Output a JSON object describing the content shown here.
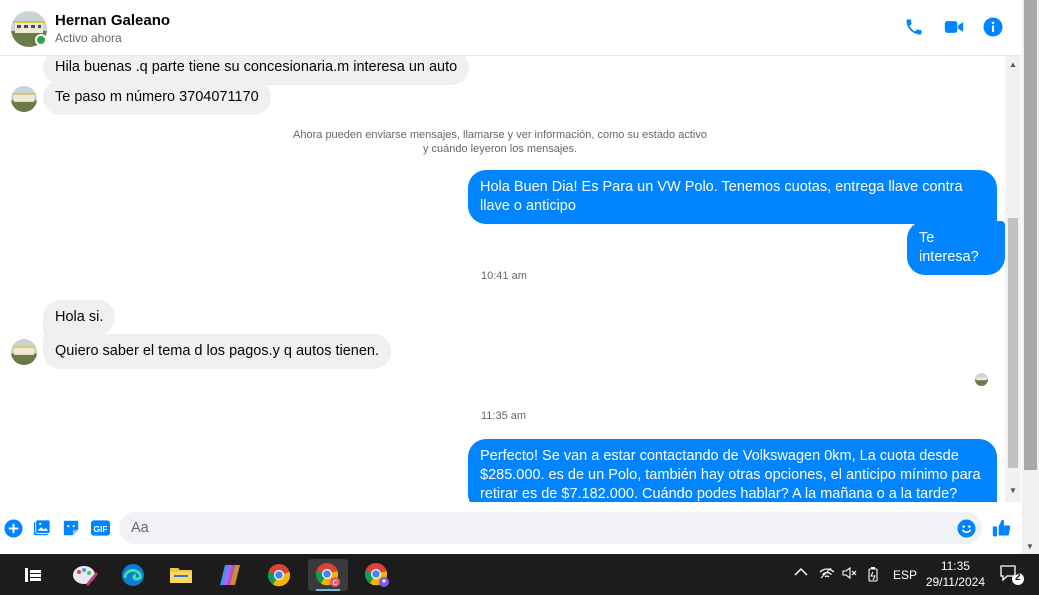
{
  "header": {
    "contact_name": "Hernan Galeano",
    "status": "Activo ahora",
    "icons": [
      "phone-icon",
      "video-icon",
      "info-icon"
    ],
    "accent": "#0084ff"
  },
  "messages": [
    {
      "dir": "in",
      "text": "Hila buenas .q parte tiene su concesionaria.m interesa un auto"
    },
    {
      "dir": "in",
      "text": "Te paso m número 3704071170"
    },
    {
      "dir": "out",
      "text": "Hola Buen Dia! Es Para un VW Polo. Tenemos cuotas, entrega llave contra llave o anticipo"
    },
    {
      "dir": "out",
      "text": "Te interesa?"
    },
    {
      "dir": "in",
      "text": "Hola si."
    },
    {
      "dir": "in",
      "text": "Quiero saber el tema d los pagos.y q autos tienen."
    },
    {
      "dir": "out",
      "text": "Perfecto!  Se van a estar contactando de Volkswagen 0km, La cuota desde $285.000. es de un Polo, también hay otras opciones, el anticipo mínimo para retirar es de $7.182.000. Cuándo podes hablar? A la mañana o a la tarde?"
    }
  ],
  "system_note": {
    "line1": "Ahora pueden enviarse mensajes, llamarse y ver información, como su estado activo",
    "line2": "y cuándo leyeron los mensajes."
  },
  "timestamps": [
    "10:41 am",
    "11:35 am"
  ],
  "composer": {
    "placeholder": "Aa",
    "icons": [
      "add-icon",
      "photo-icon",
      "sticker-icon",
      "gif-icon",
      "emoji-icon",
      "thumbs-up-icon"
    ]
  },
  "taskbar": {
    "apps": [
      "task-view-icon",
      "paint-icon",
      "edge-icon",
      "file-explorer-icon",
      "copilot-icon",
      "chrome-icon",
      "chrome-profile-c-icon",
      "chrome-profile-b-icon"
    ],
    "language": "ESP",
    "time": "11:35",
    "date": "29/11/2024",
    "notification_count": "2"
  }
}
